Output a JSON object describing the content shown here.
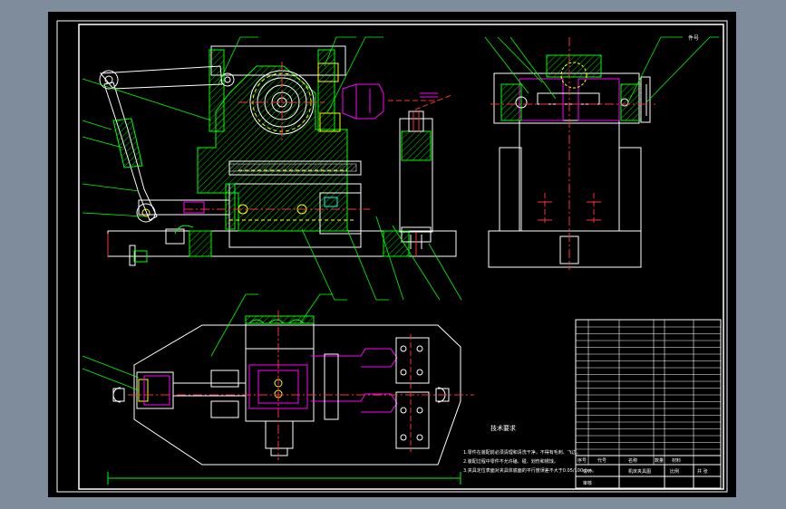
{
  "drawing": {
    "tech_title": "技术要求",
    "tech_notes": [
      "1.零件在装配前必须清理和清洗干净，不得有毛刺、飞边。",
      "2.装配过程中零件不允许磕、碰、划伤和锈蚀。",
      "3.夹具定位表面对夹具体底面的平行度误差不大于0.05/100mm。"
    ],
    "balloon_label": "件号",
    "title_block": {
      "sequence_header": "序号",
      "code_header": "代号",
      "name_header": "名称",
      "qty_header": "数量",
      "material_header": "材料",
      "drawing_name": "机床夹具图",
      "design_label": "设计",
      "check_label": "审核",
      "scale_label": "比例",
      "sheet_label": "共 张"
    }
  },
  "colors": {
    "frame": "#ffffff",
    "outline": "#ffffff",
    "hatch": "#00ff00",
    "center": "#ff3030",
    "hidden": "#ffff00",
    "part": "#ff00ff",
    "leader": "#00ff00",
    "cyan": "#00ffff"
  }
}
